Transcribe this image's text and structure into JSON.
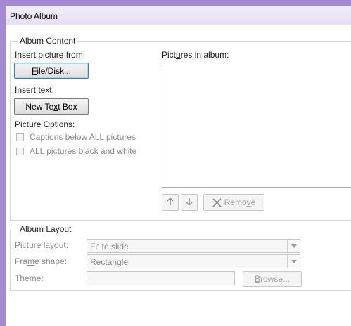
{
  "window": {
    "title": "Photo Album"
  },
  "album_content": {
    "title": "Album Content",
    "insert_picture_from": "Insert picture from:",
    "file_disk_button": {
      "pre": "",
      "u": "F",
      "post": "ile/Disk..."
    },
    "insert_text": "Insert text:",
    "new_text_box_button": {
      "pre": "New Te",
      "u": "x",
      "post": "t Box"
    },
    "picture_options": "Picture Options:",
    "captions_option": {
      "pre": "Captions below ",
      "u": "A",
      "post": "LL pictures",
      "checked": false
    },
    "black_white_option": {
      "pre": "ALL pictures blac",
      "u": "k",
      "post": " and white",
      "checked": false
    },
    "pictures_in_album": {
      "pre": "Pict",
      "u": "u",
      "post": "res in album:"
    },
    "up_icon": "arrow-up",
    "down_icon": "arrow-down",
    "remove_button": {
      "pre": "Remo",
      "u": "v",
      "post": "e"
    }
  },
  "album_layout": {
    "title": "Album Layout",
    "picture_layout": {
      "pre": "",
      "u": "P",
      "post": "icture layout:",
      "value": "Fit to slide"
    },
    "frame_shape": {
      "pre": "Fra",
      "u": "m",
      "post": "e shape:",
      "value": "Rectangle"
    },
    "theme": {
      "pre": "",
      "u": "T",
      "post": "heme:",
      "value": ""
    },
    "browse_button": {
      "pre": "",
      "u": "B",
      "post": "rowse..."
    }
  },
  "colors": {
    "frame": "#a58ad3",
    "disabled_text": "#8a8a8a"
  }
}
